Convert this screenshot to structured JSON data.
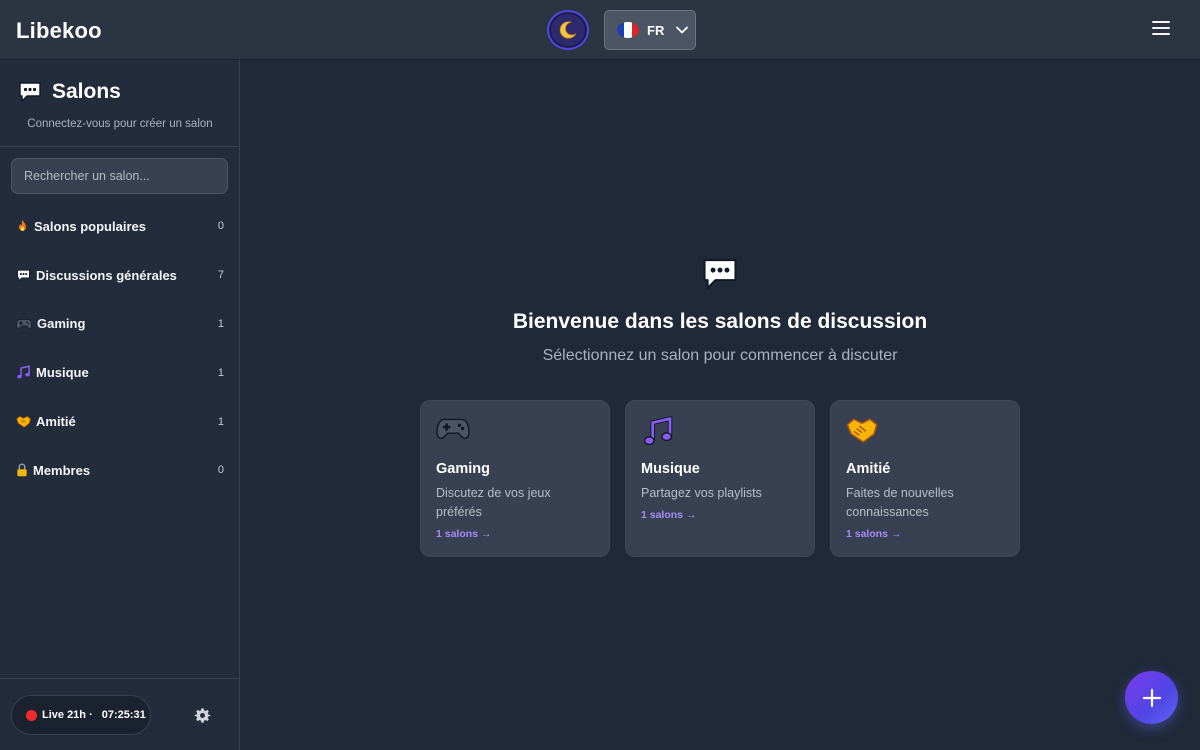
{
  "header": {
    "brand": "Libekoo",
    "lang_code": "FR",
    "theme_icon": "moon-icon",
    "menu_icon": "hamburger-menu-icon"
  },
  "sidebar": {
    "title": "Salons",
    "subtitle": "Connectez-vous pour créer un salon",
    "search_placeholder": "Rechercher un salon...",
    "categories": [
      {
        "icon": "fire-icon",
        "label": "Salons populaires",
        "count": "0"
      },
      {
        "icon": "speech-bubble-icon",
        "label": "Discussions générales",
        "count": "7"
      },
      {
        "icon": "gamepad-icon",
        "label": "Gaming",
        "count": "1"
      },
      {
        "icon": "music-note-icon",
        "label": "Musique",
        "count": "1"
      },
      {
        "icon": "handshake-icon",
        "label": "Amitié",
        "count": "1"
      },
      {
        "icon": "lock-icon",
        "label": "Membres",
        "count": "0"
      }
    ],
    "live_label": "Live 21h ·",
    "live_time": "07:25:31"
  },
  "main": {
    "title": "Bienvenue dans les salons de discussion",
    "subtitle": "Sélectionnez un salon pour commencer à discuter",
    "cards": [
      {
        "icon": "gamepad-icon",
        "title": "Gaming",
        "description": "Discutez de vos jeux préférés",
        "link": "1 salons →"
      },
      {
        "icon": "music-note-icon",
        "title": "Musique",
        "description": "Partagez vos playlists",
        "link": "1 salons →"
      },
      {
        "icon": "handshake-icon",
        "title": "Amitié",
        "description": "Faites de nouvelles connaissances",
        "link": "1 salons →"
      }
    ]
  },
  "colors": {
    "background": "#1f2937",
    "sidebar": "#232c3a",
    "card": "#374151",
    "accent": "#a78bfa",
    "live_dot": "#ef2b2b"
  }
}
